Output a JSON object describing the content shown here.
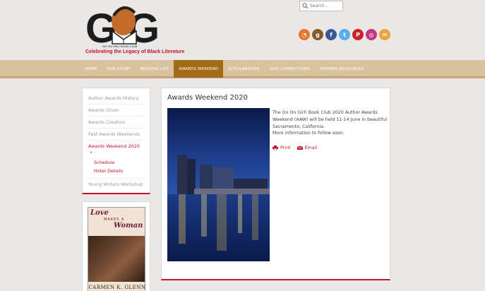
{
  "logo": {
    "club": "GO ON GIRL! BOOK CLUB",
    "tagline": "Celebrating the Legacy of Black Literature"
  },
  "search": {
    "placeholder": "Search..."
  },
  "social": [
    {
      "name": "rss-icon",
      "color": "#e8772e",
      "glyph": "◔"
    },
    {
      "name": "goodreads-icon",
      "color": "#8b5a2b",
      "glyph": "g"
    },
    {
      "name": "facebook-icon",
      "color": "#3b5998",
      "glyph": "f"
    },
    {
      "name": "twitter-icon",
      "color": "#55acee",
      "glyph": "t"
    },
    {
      "name": "pinterest-icon",
      "color": "#cb2027",
      "glyph": "P"
    },
    {
      "name": "instagram-icon",
      "color": "#c13584",
      "glyph": "◎"
    },
    {
      "name": "email-icon",
      "color": "#e8a33d",
      "glyph": "✉"
    }
  ],
  "nav": [
    "HOME",
    "OUR STORY",
    "READING LIST",
    "AWARDS WEEKEND",
    "SCHOLARSHIPS",
    "GOG CONNECTIONS",
    "MEMBER RESOURCES"
  ],
  "nav_active": "AWARDS WEEKEND",
  "sidebar": {
    "items": [
      "Author Awards History",
      "Awards Given",
      "Awards Creators",
      "Past Awards Weekends"
    ],
    "active": "Awards Weekend 2020",
    "subitems": [
      "Schedule",
      "Hotel Details"
    ],
    "last": "Young Writers Workshop"
  },
  "book": {
    "title_line1": "Love",
    "title_line2": "MAKES A",
    "title_line3": "Woman",
    "author": "CARMEN K. GLENN"
  },
  "main": {
    "title": "Awards Weekend 2020",
    "paragraph1": "The Go On Girl! Book Club 2020 Author Awards Weekend (AAW) will be held 11-14 June in beautiful Sacramento, California.",
    "paragraph2": "More information to follow soon.",
    "print_label": "Print",
    "email_label": "Email"
  }
}
